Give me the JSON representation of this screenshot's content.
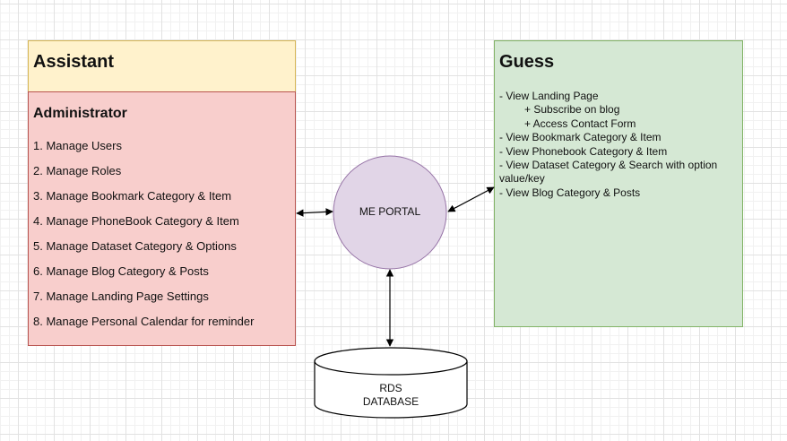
{
  "assistant": {
    "title": "Assistant"
  },
  "administrator": {
    "title": "Administrator",
    "items": [
      "1. Manage Users",
      "2. Manage Roles",
      "3. Manage Bookmark Category & Item",
      "4. Manage PhoneBook Category & Item",
      "5. Manage Dataset Category & Options",
      "6. Manage Blog Category & Posts",
      "7. Manage Landing Page Settings",
      "8. Manage Personal Calendar for reminder"
    ]
  },
  "guess": {
    "title": "Guess",
    "items": [
      "- View Landing Page",
      "+ Subscribe on blog",
      "+ Access Contact Form",
      "- View Bookmark Category & Item",
      "- View Phonebook Category & Item",
      "- View Dataset Category & Search with option value/key",
      "- View Blog Category & Posts"
    ]
  },
  "portal": {
    "label": "ME PORTAL"
  },
  "database": {
    "line1": "RDS",
    "line2": "DATABASE"
  },
  "colors": {
    "assistant_fill": "#fff2cc",
    "assistant_stroke": "#d6b656",
    "admin_fill": "#f8cecc",
    "admin_stroke": "#b85450",
    "guess_fill": "#d5e8d4",
    "guess_stroke": "#82b366",
    "portal_fill": "#e1d5e7",
    "portal_stroke": "#9673a6"
  }
}
